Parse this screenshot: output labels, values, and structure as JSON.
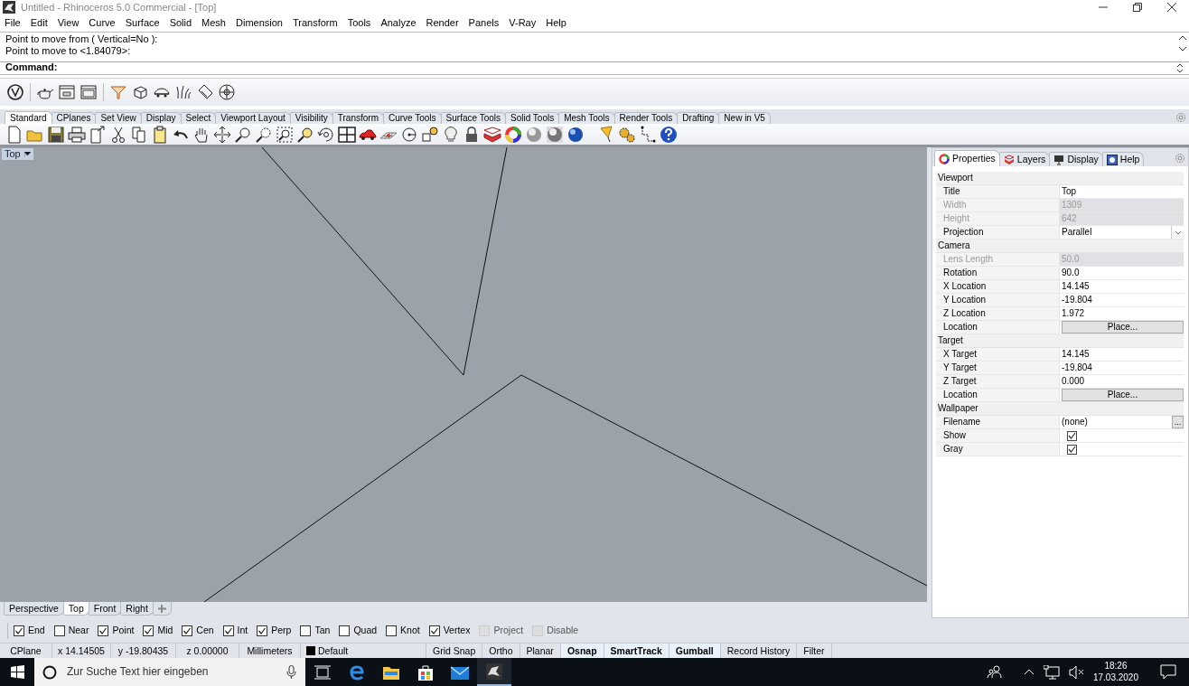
{
  "window": {
    "title": "Untitled - Rhinoceros 5.0 Commercial - [Top]"
  },
  "menu": [
    "File",
    "Edit",
    "View",
    "Curve",
    "Surface",
    "Solid",
    "Mesh",
    "Dimension",
    "Transform",
    "Tools",
    "Analyze",
    "Render",
    "Panels",
    "V-Ray",
    "Help"
  ],
  "command_history": [
    "Point to move from ( Vertical=No ):",
    "Point to move to <1.84079>:"
  ],
  "command_prompt": "Command:",
  "toolbar_tabs": [
    {
      "label": "Standard",
      "selected": true
    },
    {
      "label": "CPlanes",
      "selected": false
    },
    {
      "label": "Set View",
      "selected": false
    },
    {
      "label": "Display",
      "selected": false
    },
    {
      "label": "Select",
      "selected": false
    },
    {
      "label": "Viewport Layout",
      "selected": false
    },
    {
      "label": "Visibility",
      "selected": false
    },
    {
      "label": "Transform",
      "selected": false
    },
    {
      "label": "Curve Tools",
      "selected": false
    },
    {
      "label": "Surface Tools",
      "selected": false
    },
    {
      "label": "Solid Tools",
      "selected": false
    },
    {
      "label": "Mesh Tools",
      "selected": false
    },
    {
      "label": "Render Tools",
      "selected": false
    },
    {
      "label": "Drafting",
      "selected": false
    },
    {
      "label": "New in V5",
      "selected": false
    }
  ],
  "viewport": {
    "label": "Top"
  },
  "viewport_tabs": [
    {
      "label": "Perspective",
      "selected": false
    },
    {
      "label": "Top",
      "selected": true
    },
    {
      "label": "Front",
      "selected": false
    },
    {
      "label": "Right",
      "selected": false
    }
  ],
  "panel_tabs": [
    {
      "label": "Properties",
      "selected": true
    },
    {
      "label": "Layers",
      "selected": false
    },
    {
      "label": "Display",
      "selected": false
    },
    {
      "label": "Help",
      "selected": false
    }
  ],
  "properties": [
    {
      "title": "Viewport",
      "rows": [
        {
          "label": "Title",
          "kind": "text",
          "value": "Top",
          "disabled": false
        },
        {
          "label": "Width",
          "kind": "text",
          "value": "1309",
          "disabled": true
        },
        {
          "label": "Height",
          "kind": "text",
          "value": "642",
          "disabled": true
        },
        {
          "label": "Projection",
          "kind": "dropdown",
          "value": "Parallel",
          "disabled": false
        }
      ]
    },
    {
      "title": "Camera",
      "rows": [
        {
          "label": "Lens Length",
          "kind": "text",
          "value": "50.0",
          "disabled": true
        },
        {
          "label": "Rotation",
          "kind": "text",
          "value": "90.0",
          "disabled": false
        },
        {
          "label": "X Location",
          "kind": "text",
          "value": "14.145",
          "disabled": false
        },
        {
          "label": "Y Location",
          "kind": "text",
          "value": "-19.804",
          "disabled": false
        },
        {
          "label": "Z Location",
          "kind": "text",
          "value": "1.972",
          "disabled": false
        },
        {
          "label": "Location",
          "kind": "button",
          "value": "Place...",
          "disabled": false
        }
      ]
    },
    {
      "title": "Target",
      "rows": [
        {
          "label": "X Target",
          "kind": "text",
          "value": "14.145",
          "disabled": false
        },
        {
          "label": "Y Target",
          "kind": "text",
          "value": "-19.804",
          "disabled": false
        },
        {
          "label": "Z Target",
          "kind": "text",
          "value": "0.000",
          "disabled": false
        },
        {
          "label": "Location",
          "kind": "button",
          "value": "Place...",
          "disabled": false
        }
      ]
    },
    {
      "title": "Wallpaper",
      "rows": [
        {
          "label": "Filename",
          "kind": "file",
          "value": "(none)",
          "button_label": "...",
          "disabled": false
        },
        {
          "label": "Show",
          "kind": "checkbox",
          "checked": true,
          "disabled": false
        },
        {
          "label": "Gray",
          "kind": "checkbox",
          "checked": true,
          "disabled": false
        }
      ]
    }
  ],
  "osnaps": [
    {
      "label": "End",
      "checked": true,
      "disabled": false
    },
    {
      "label": "Near",
      "checked": false,
      "disabled": false
    },
    {
      "label": "Point",
      "checked": true,
      "disabled": false
    },
    {
      "label": "Mid",
      "checked": true,
      "disabled": false
    },
    {
      "label": "Cen",
      "checked": true,
      "disabled": false
    },
    {
      "label": "Int",
      "checked": true,
      "disabled": false
    },
    {
      "label": "Perp",
      "checked": true,
      "disabled": false
    },
    {
      "label": "Tan",
      "checked": false,
      "disabled": false
    },
    {
      "label": "Quad",
      "checked": false,
      "disabled": false
    },
    {
      "label": "Knot",
      "checked": false,
      "disabled": false
    },
    {
      "label": "Vertex",
      "checked": true,
      "disabled": false
    },
    {
      "label": "Project",
      "checked": false,
      "disabled": true
    },
    {
      "label": "Disable",
      "checked": false,
      "disabled": true
    }
  ],
  "status_bar": {
    "cplane": "CPlane",
    "x": "x 14.14505",
    "y": "y -19.80435",
    "z": "z 0.00000",
    "units": "Millimeters",
    "layer": "Default",
    "toggles": [
      {
        "label": "Grid Snap",
        "on": false
      },
      {
        "label": "Ortho",
        "on": false
      },
      {
        "label": "Planar",
        "on": false
      },
      {
        "label": "Osnap",
        "on": true
      },
      {
        "label": "SmartTrack",
        "on": true
      },
      {
        "label": "Gumball",
        "on": true
      },
      {
        "label": "Record History",
        "on": false
      },
      {
        "label": "Filter",
        "on": false
      }
    ]
  },
  "taskbar": {
    "search_placeholder": "Zur Suche Text hier eingeben",
    "time": "18:26",
    "date": "17.03.2020"
  }
}
